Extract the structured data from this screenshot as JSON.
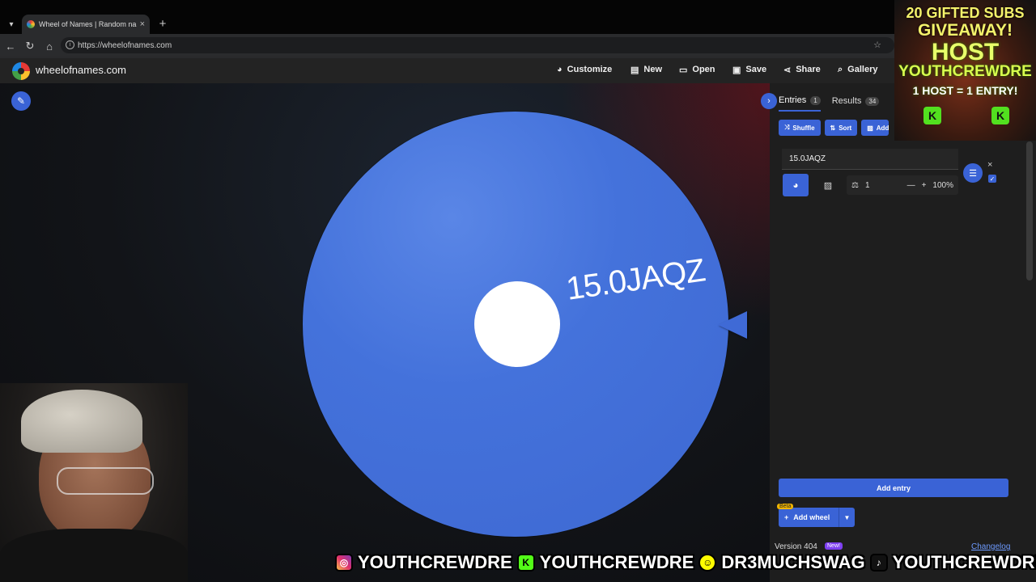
{
  "browser": {
    "tab_title": "Wheel of Names | Random name p",
    "tab_close": "×",
    "new_tab": "+",
    "url": "https://wheelofnames.com"
  },
  "site": {
    "name": "wheelofnames.com",
    "nav": [
      {
        "label": "Customize",
        "icon": "palette-icon"
      },
      {
        "label": "New",
        "icon": "file-icon"
      },
      {
        "label": "Open",
        "icon": "folder-icon"
      },
      {
        "label": "Save",
        "icon": "save-icon"
      },
      {
        "label": "Share",
        "icon": "share-icon"
      },
      {
        "label": "Gallery",
        "icon": "search-icon"
      }
    ]
  },
  "wheel": {
    "label": "15.0JAQZ",
    "color": "#4471db"
  },
  "panel": {
    "tabs": [
      {
        "label": "Entries",
        "count": "1"
      },
      {
        "label": "Results",
        "count": "34"
      }
    ],
    "actions": [
      "Shuffle",
      "Sort",
      "Add"
    ],
    "entry": {
      "text": "15.0JAQZ",
      "weight": "1",
      "minus": "—",
      "plus": "+",
      "percent": "100%",
      "remove": "×",
      "check": "✓"
    },
    "add_entry": "Add entry",
    "add_wheel": "Add wheel",
    "beta": "Beta",
    "version": "Version 404",
    "new_badge": "New!",
    "changelog": "Changelog"
  },
  "overlay": {
    "promo": {
      "line1": "20 GIFTED SUBS",
      "line2": "GIVEAWAY!",
      "line3": "HOST",
      "line4": "YOUTHCREWDRE",
      "line5": "1 HOST = 1 ENTRY!",
      "coin": "K"
    },
    "social": [
      {
        "platform": "instagram",
        "icon": "instagram-icon",
        "handle": "YOUTHCREWDRE"
      },
      {
        "platform": "kick",
        "icon": "kick-icon",
        "handle": "YOUTHCREWDRE"
      },
      {
        "platform": "snapchat",
        "icon": "snapchat-icon",
        "handle": "DR3MUCHSWAG"
      },
      {
        "platform": "tiktok",
        "icon": "tiktok-icon",
        "handle": "YOUTHCREWDRE"
      }
    ]
  },
  "colors": {
    "accent": "#3a63d6",
    "header_bg": "#232323",
    "panel_bg": "#1e1e1e"
  }
}
